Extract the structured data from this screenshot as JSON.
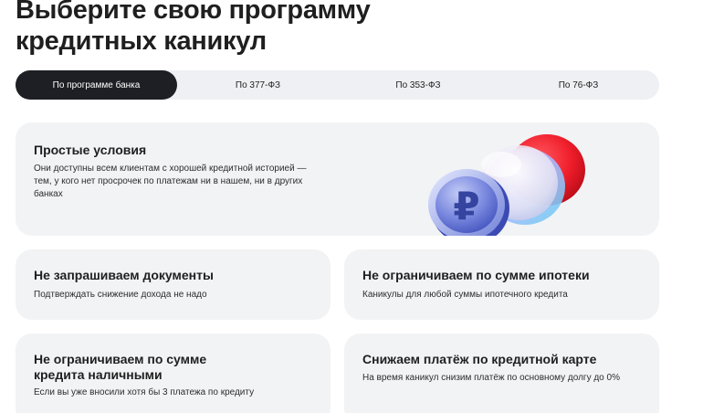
{
  "heading": {
    "line1": "Выберите свою программу",
    "line2": "кредитных каникул"
  },
  "tabs": [
    {
      "label": "По программе банка",
      "active": true
    },
    {
      "label": "По 377-ФЗ",
      "active": false
    },
    {
      "label": "По 353-ФЗ",
      "active": false
    },
    {
      "label": "По 76-ФЗ",
      "active": false
    }
  ],
  "hero": {
    "title": "Простые условия",
    "text": "Они доступны всем клиентам с хорошей кредитной историей — тем, у кого нет просрочек по платежам ни в нашем, ни в других банках",
    "illustration": "ruble-coins-illustration",
    "coin_symbol": "₽"
  },
  "features": [
    {
      "title": "Не запрашиваем документы",
      "text": "Подтверждать снижение дохода не надо"
    },
    {
      "title": "Не ограничиваем по сумме ипотеки",
      "text": "Каникулы для любой суммы ипотечного кредита"
    },
    {
      "title": "Не ограничиваем по сумме кредита наличными",
      "text": "Если вы уже вносили хотя бы 3 платежа по кредиту"
    },
    {
      "title": "Снижаем платёж по кредитной карте",
      "text": "На время каникул снизим платёж по основному долгу до 0%"
    }
  ],
  "colors": {
    "tab_active_bg": "#1e1f24",
    "tabs_bg": "#eef0f3",
    "card_bg": "#f2f3f5",
    "coin_red": "#ef1d2a",
    "coin_blue": "#5a6fd8"
  }
}
